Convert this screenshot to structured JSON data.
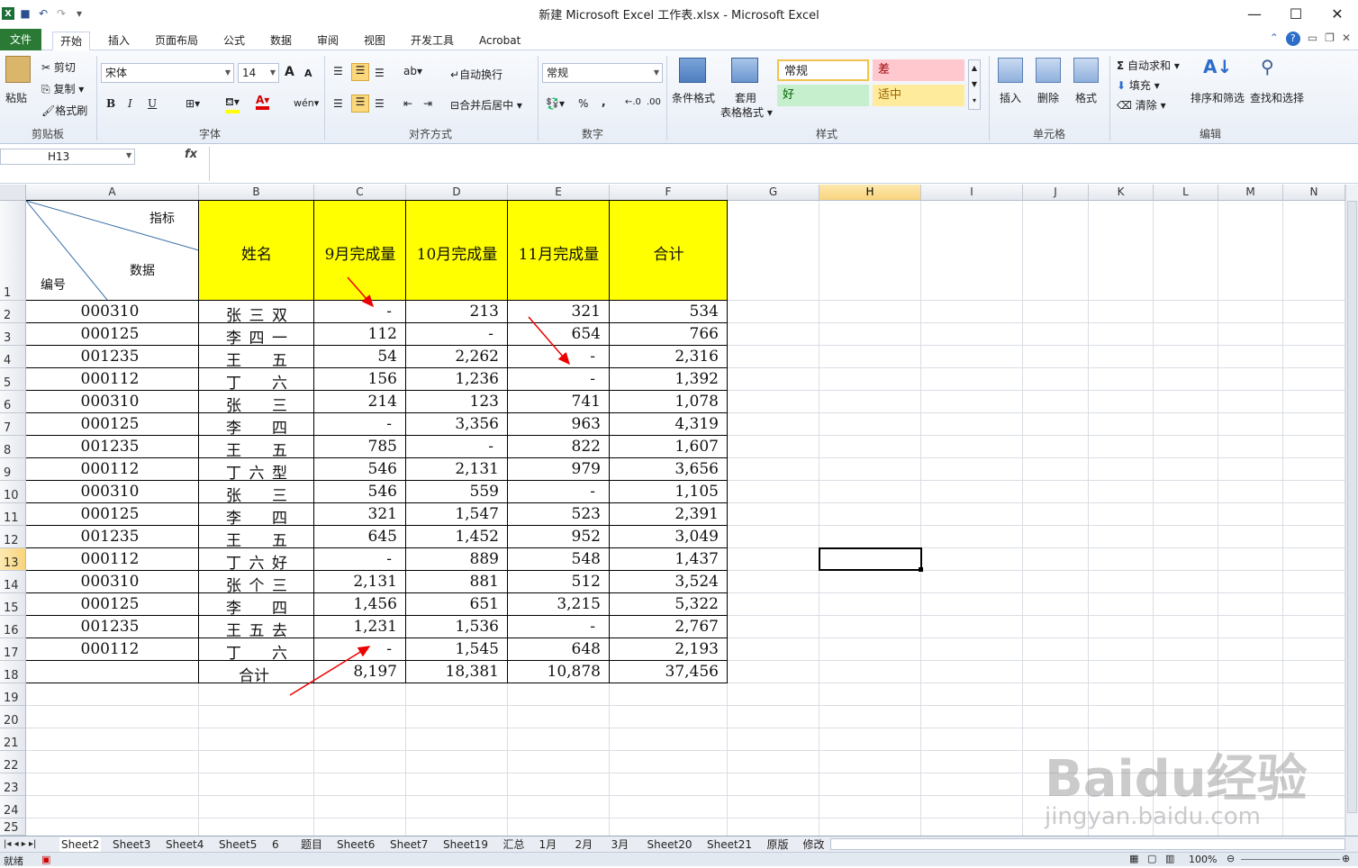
{
  "window": {
    "title": "新建 Microsoft Excel 工作表.xlsx - Microsoft Excel"
  },
  "tabs": [
    "文件",
    "开始",
    "插入",
    "页面布局",
    "公式",
    "数据",
    "审阅",
    "视图",
    "开发工具",
    "Acrobat"
  ],
  "ribbon": {
    "clipboard": {
      "paste": "粘贴",
      "cut": "剪切",
      "copy": "复制",
      "format_painter": "格式刷",
      "label": "剪贴板"
    },
    "font": {
      "name": "宋体",
      "size": "14",
      "bold": "B",
      "italic": "I",
      "underline": "U",
      "label": "字体",
      "grow": "A",
      "shrink": "A",
      "phonetic": "wén"
    },
    "alignment": {
      "wrap": "自动换行",
      "merge": "合并后居中",
      "label": "对齐方式"
    },
    "number": {
      "format": "常规",
      "percent": "%",
      "comma": ",",
      "label": "数字"
    },
    "styles": {
      "conditional": "条件格式",
      "table_format_1": "套用",
      "table_format_2": "表格格式",
      "normal": "常规",
      "bad": "差",
      "good": "好",
      "neutral": "适中",
      "label": "样式"
    },
    "cells": {
      "insert": "插入",
      "delete": "删除",
      "format": "格式",
      "label": "单元格"
    },
    "editing": {
      "autosum": "自动求和",
      "fill": "填充",
      "clear": "清除",
      "sort": "排序和筛选",
      "find": "查找和选择",
      "label": "编辑"
    }
  },
  "formula_bar": {
    "name_box": "H13",
    "fx": "fx",
    "content": ""
  },
  "columns": [
    "A",
    "B",
    "C",
    "D",
    "E",
    "F",
    "G",
    "H",
    "I",
    "J",
    "K",
    "L",
    "M",
    "N"
  ],
  "rows": [
    "1",
    "2",
    "3",
    "4",
    "5",
    "6",
    "7",
    "8",
    "9",
    "10",
    "11",
    "12",
    "13",
    "14",
    "15",
    "16",
    "17",
    "18",
    "19",
    "20",
    "21",
    "22",
    "23",
    "24",
    "25"
  ],
  "header": {
    "diag_top": "指标",
    "diag_mid": "数据",
    "diag_bottom": "编号",
    "name": "姓名",
    "sep": "9月完成量",
    "oct": "10月完成量",
    "nov": "11月完成量",
    "total": "合计"
  },
  "table": [
    [
      "000310",
      "张三双",
      "-",
      "213",
      "321",
      "534"
    ],
    [
      "000125",
      "李四一",
      "112",
      "-",
      "654",
      "766"
    ],
    [
      "001235",
      "王  五",
      "54",
      "2,262",
      "-",
      "2,316"
    ],
    [
      "000112",
      "丁  六",
      "156",
      "1,236",
      "-",
      "1,392"
    ],
    [
      "000310",
      "张  三",
      "214",
      "123",
      "741",
      "1,078"
    ],
    [
      "000125",
      "李  四",
      "-",
      "3,356",
      "963",
      "4,319"
    ],
    [
      "001235",
      "王  五",
      "785",
      "-",
      "822",
      "1,607"
    ],
    [
      "000112",
      "丁六型",
      "546",
      "2,131",
      "979",
      "3,656"
    ],
    [
      "000310",
      "张  三",
      "546",
      "559",
      "-",
      "1,105"
    ],
    [
      "000125",
      "李  四",
      "321",
      "1,547",
      "523",
      "2,391"
    ],
    [
      "001235",
      "王  五",
      "645",
      "1,452",
      "952",
      "3,049"
    ],
    [
      "000112",
      "丁六好",
      "-",
      "889",
      "548",
      "1,437"
    ],
    [
      "000310",
      "张个三",
      "2,131",
      "881",
      "512",
      "3,524"
    ],
    [
      "000125",
      "李  四",
      "1,456",
      "651",
      "3,215",
      "5,322"
    ],
    [
      "001235",
      "王五去",
      "1,231",
      "1,536",
      "-",
      "2,767"
    ],
    [
      "000112",
      "丁  六",
      "-",
      "1,545",
      "648",
      "2,193"
    ]
  ],
  "total_row": {
    "label": "合计",
    "sep": "8,197",
    "oct": "18,381",
    "nov": "10,878",
    "total": "37,456"
  },
  "sheets": [
    "Sheet2",
    "Sheet3",
    "Sheet4",
    "Sheet5",
    "6",
    "题目",
    "Sheet6",
    "Sheet7",
    "Sheet19",
    "汇总",
    "1月",
    "2月",
    "3月",
    "Sheet20",
    "Sheet21",
    "原版",
    "修改"
  ],
  "status": {
    "ready": "就绪",
    "zoom": "100%"
  },
  "watermark": {
    "brand": "Baidu经验",
    "url": "jingyan.baidu.com"
  }
}
